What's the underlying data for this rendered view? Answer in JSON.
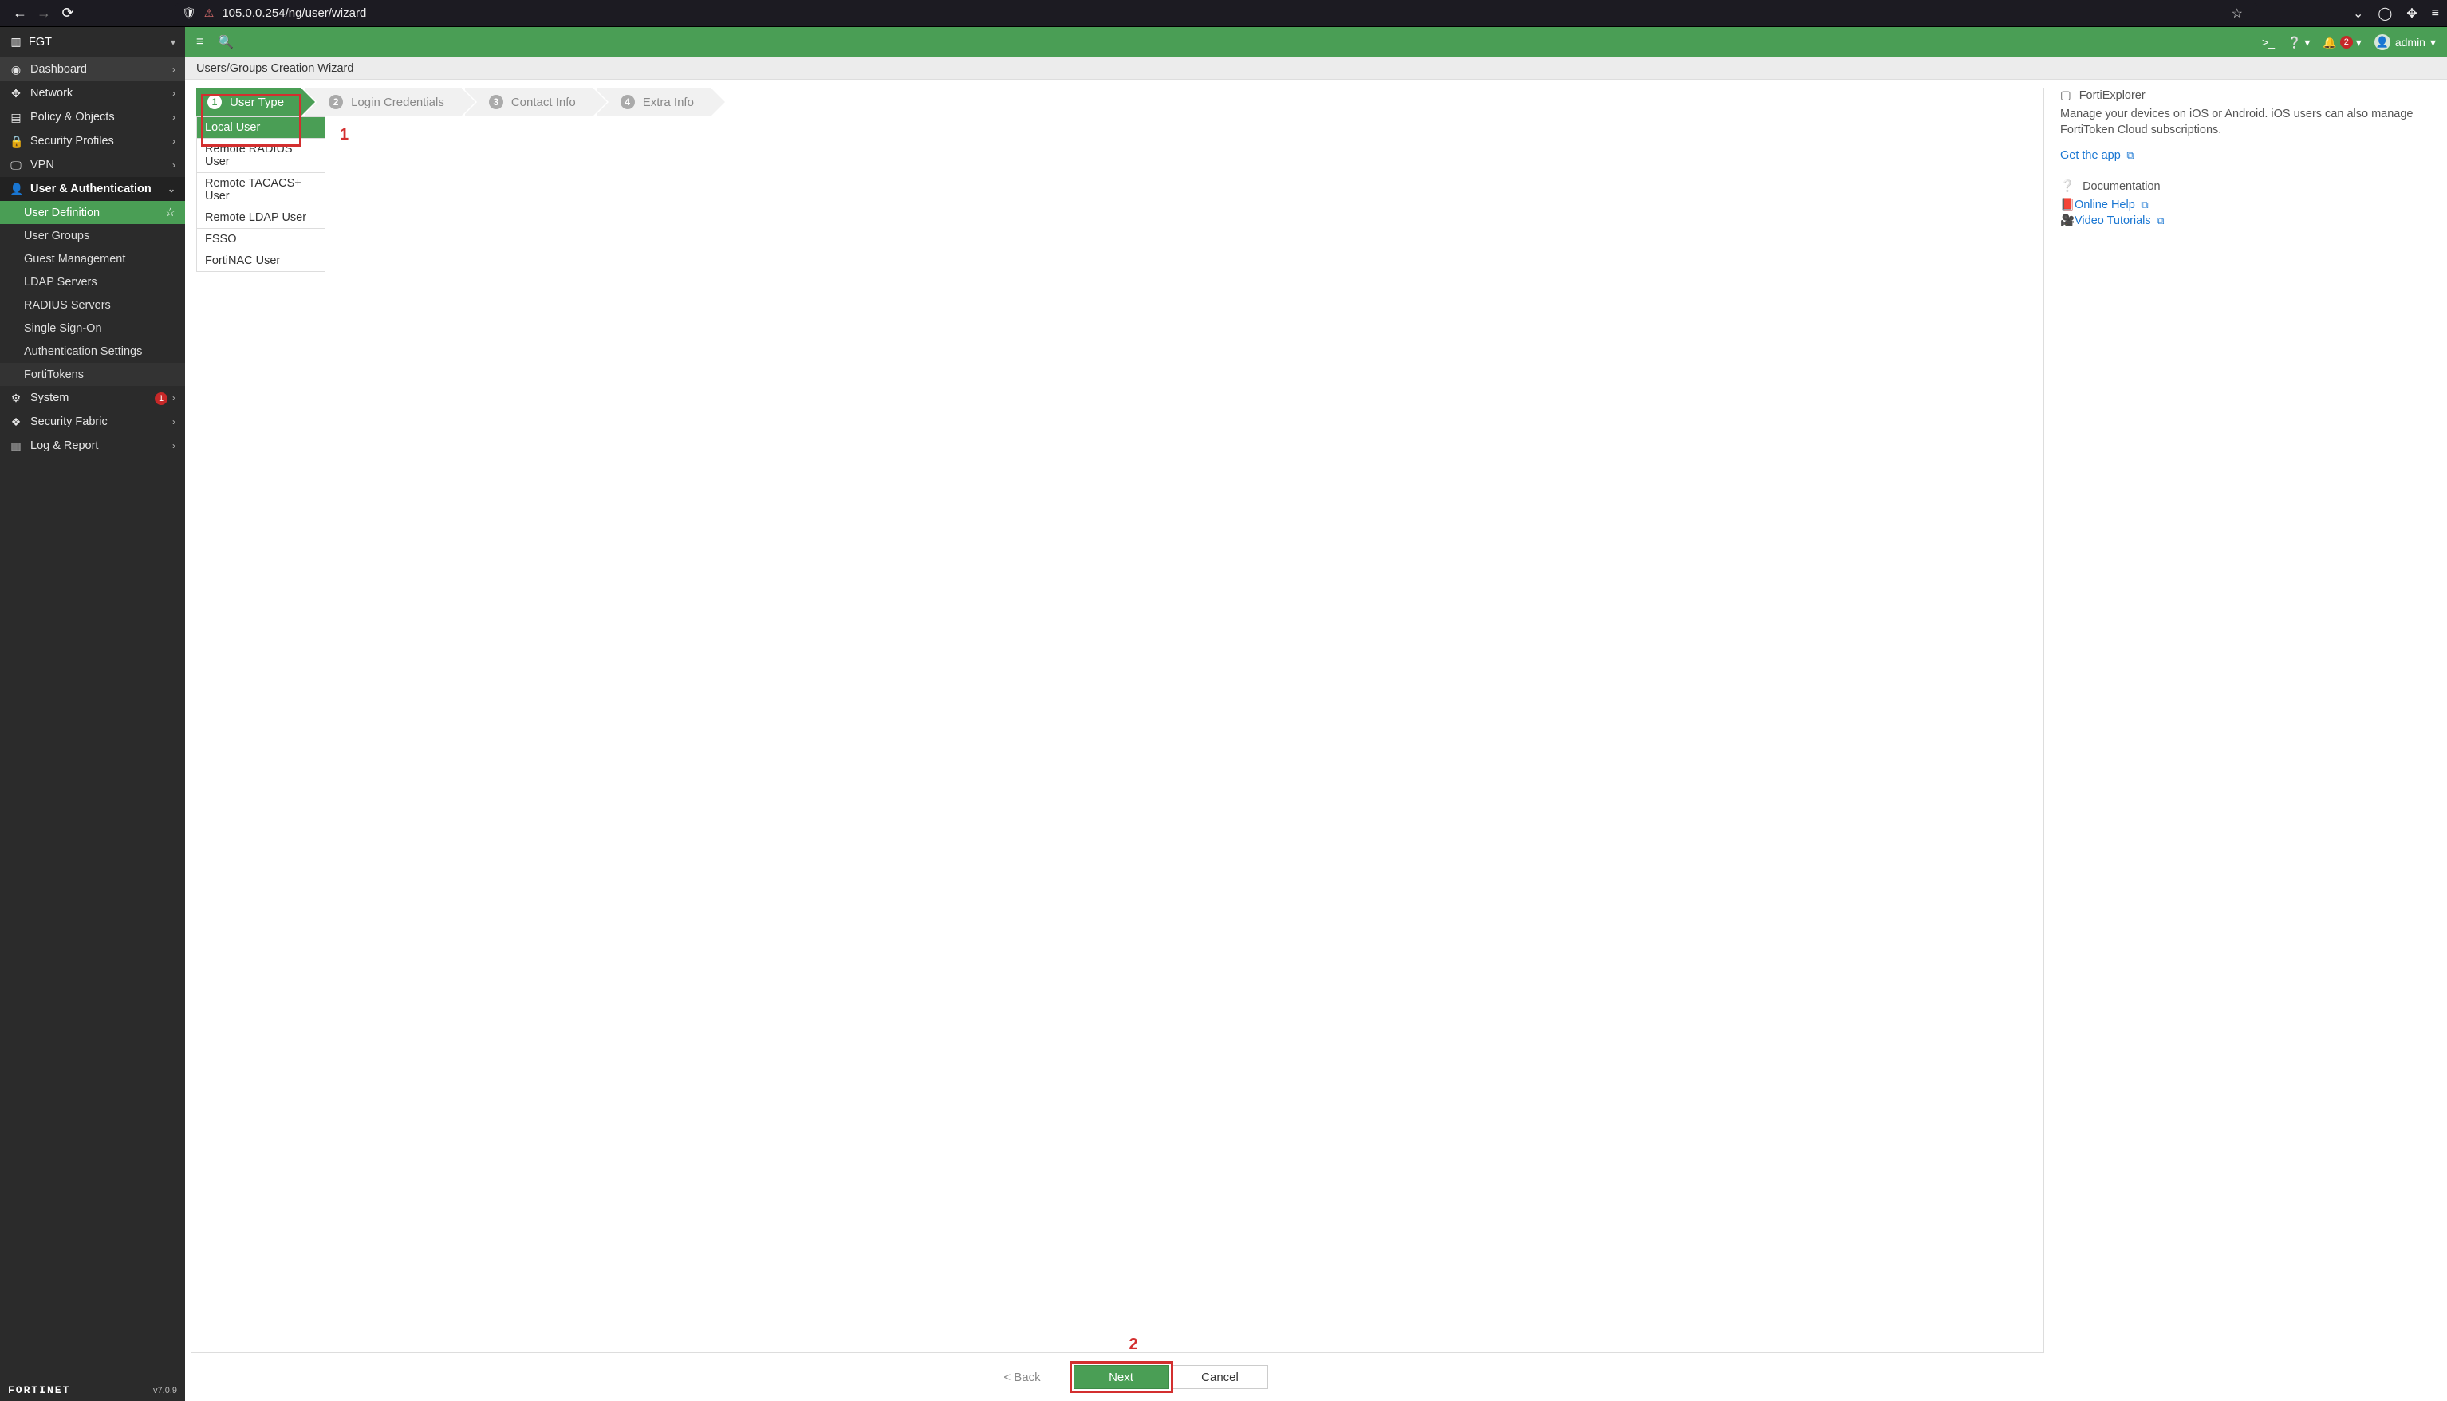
{
  "browser": {
    "url": "105.0.0.254/ng/user/wizard"
  },
  "device_name": "FGT",
  "sidebar": {
    "items": [
      {
        "label": "Dashboard"
      },
      {
        "label": "Network"
      },
      {
        "label": "Policy & Objects"
      },
      {
        "label": "Security Profiles"
      },
      {
        "label": "VPN"
      },
      {
        "label": "User & Authentication"
      },
      {
        "label": "System"
      },
      {
        "label": "Security Fabric"
      },
      {
        "label": "Log & Report"
      }
    ],
    "user_auth_sub": [
      "User Definition",
      "User Groups",
      "Guest Management",
      "LDAP Servers",
      "RADIUS Servers",
      "Single Sign-On",
      "Authentication Settings",
      "FortiTokens"
    ],
    "system_badge": "1",
    "version": "v7.0.9",
    "brand": "FORTINET"
  },
  "topbar": {
    "notif_count": "2",
    "user": "admin"
  },
  "breadcrumb": "Users/Groups Creation Wizard",
  "wizard": {
    "steps": [
      "User Type",
      "Login Credentials",
      "Contact Info",
      "Extra Info"
    ],
    "options": [
      "Local User",
      "Remote RADIUS User",
      "Remote TACACS+ User",
      "Remote LDAP User",
      "FSSO",
      "FortiNAC User"
    ],
    "buttons": {
      "back": "< Back",
      "next": "Next",
      "cancel": "Cancel"
    }
  },
  "annotations": {
    "a1": "1",
    "a2": "2"
  },
  "rightpane": {
    "fx_title": "FortiExplorer",
    "fx_desc": "Manage your devices on iOS or Android. iOS users can also manage FortiToken Cloud subscriptions.",
    "get_app": "Get the app",
    "doc_title": "Documentation",
    "doc_links": [
      "Online Help",
      "Video Tutorials"
    ]
  }
}
